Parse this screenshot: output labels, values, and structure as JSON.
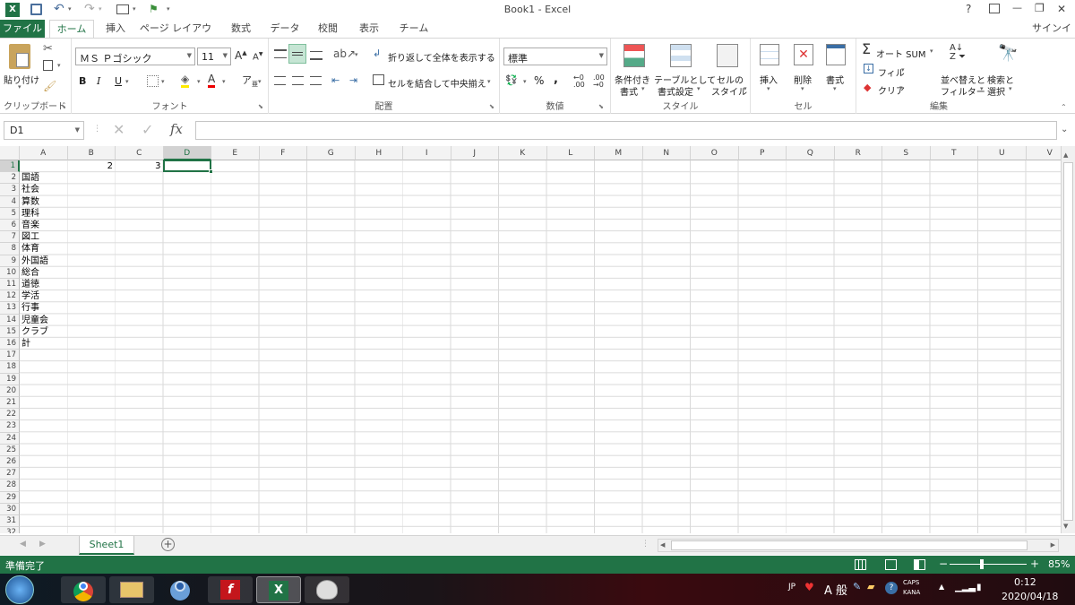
{
  "titlebar": {
    "title": "Book1 - Excel",
    "help": "?",
    "minimize": "—",
    "restore": "❐",
    "close": "✕"
  },
  "tabs": {
    "file": "ファイル",
    "home": "ホーム",
    "insert": "挿入",
    "layout": "ページ レイアウト",
    "formulas": "数式",
    "data": "データ",
    "review": "校閲",
    "view": "表示",
    "team": "チーム",
    "signin": "サインイン"
  },
  "ribbon": {
    "clipboard": {
      "paste": "貼り付け",
      "label": "クリップボード"
    },
    "font": {
      "name": "ＭＳ Ｐゴシック",
      "size": "11",
      "bold": "B",
      "italic": "I",
      "underline": "U",
      "label": "フォント"
    },
    "alignment": {
      "wrap": "折り返して全体を表示する",
      "merge": "セルを結合して中央揃え",
      "label": "配置"
    },
    "number": {
      "format": "標準",
      "percent": "%",
      "comma": ",",
      "label": "数値"
    },
    "styles": {
      "conditional": "条件付き",
      "conditional2": "書式",
      "table": "テーブルとして",
      "table2": "書式設定",
      "cellstyle": "セルの",
      "cellstyle2": "スタイル",
      "label": "スタイル"
    },
    "cells": {
      "insert": "挿入",
      "delete": "削除",
      "format": "書式",
      "label": "セル"
    },
    "editing": {
      "autosum": "オート SUM",
      "fill": "フィル",
      "clear": "クリア",
      "sort": "並べ替えと",
      "sort2": "フィルター",
      "find": "検索と",
      "find2": "選択",
      "label": "編集"
    }
  },
  "formulabar": {
    "namebox": "D1",
    "fx": "fx",
    "value": ""
  },
  "columns": [
    "A",
    "B",
    "C",
    "D",
    "E",
    "F",
    "G",
    "H",
    "I",
    "J",
    "K",
    "L",
    "M",
    "N",
    "O",
    "P",
    "Q",
    "R",
    "S",
    "T",
    "U",
    "V"
  ],
  "rows": [
    "1",
    "2",
    "3",
    "4",
    "5",
    "6",
    "7",
    "8",
    "9",
    "10",
    "11",
    "12",
    "13",
    "14",
    "15",
    "16",
    "17",
    "18",
    "19",
    "20",
    "21",
    "22",
    "23",
    "24",
    "25",
    "26",
    "27",
    "28",
    "29",
    "30",
    "31",
    "32"
  ],
  "cells": {
    "B1": "2",
    "C1": "3",
    "A2": "国語",
    "A3": "社会",
    "A4": "算数",
    "A5": "理科",
    "A6": "音楽",
    "A7": "図工",
    "A8": "体育",
    "A9": "外国語",
    "A10": "総合",
    "A11": "道徳",
    "A12": "学活",
    "A13": "行事",
    "A14": "児童会",
    "A15": "クラブ",
    "A16": "計"
  },
  "sheets": {
    "active": "Sheet1",
    "add": "+"
  },
  "status": {
    "ready": "準備完了",
    "zoom": "85%",
    "minus": "−",
    "plus": "+"
  },
  "taskbar": {
    "lang": "JP",
    "ime": "A 般",
    "caps": "CAPS",
    "kana": "KANA",
    "time": "0:12",
    "date": "2020/04/18"
  },
  "colors": {
    "excel_green": "#217346",
    "selected": "#217346"
  }
}
